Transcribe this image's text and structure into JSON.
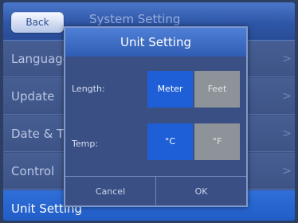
{
  "header": {
    "back_label": "Back",
    "title": "System Setting"
  },
  "menu": {
    "items": [
      {
        "label": "Language"
      },
      {
        "label": "Update"
      },
      {
        "label": "Date & Time"
      },
      {
        "label": "Control"
      },
      {
        "label": "Unit Setting"
      }
    ],
    "chevron": ">"
  },
  "dialog": {
    "title": "Unit Setting",
    "length": {
      "label": "Length:",
      "options": [
        "Meter",
        "Feet"
      ],
      "selected": "Meter"
    },
    "temp": {
      "label": "Temp:",
      "options": [
        "°C",
        "°F"
      ],
      "selected": "°C"
    },
    "cancel_label": "Cancel",
    "ok_label": "OK"
  },
  "colors": {
    "selected_option": "#1e5fd8",
    "unselected_option": "#8d9399",
    "selected_menu": "#2f6fd9"
  }
}
